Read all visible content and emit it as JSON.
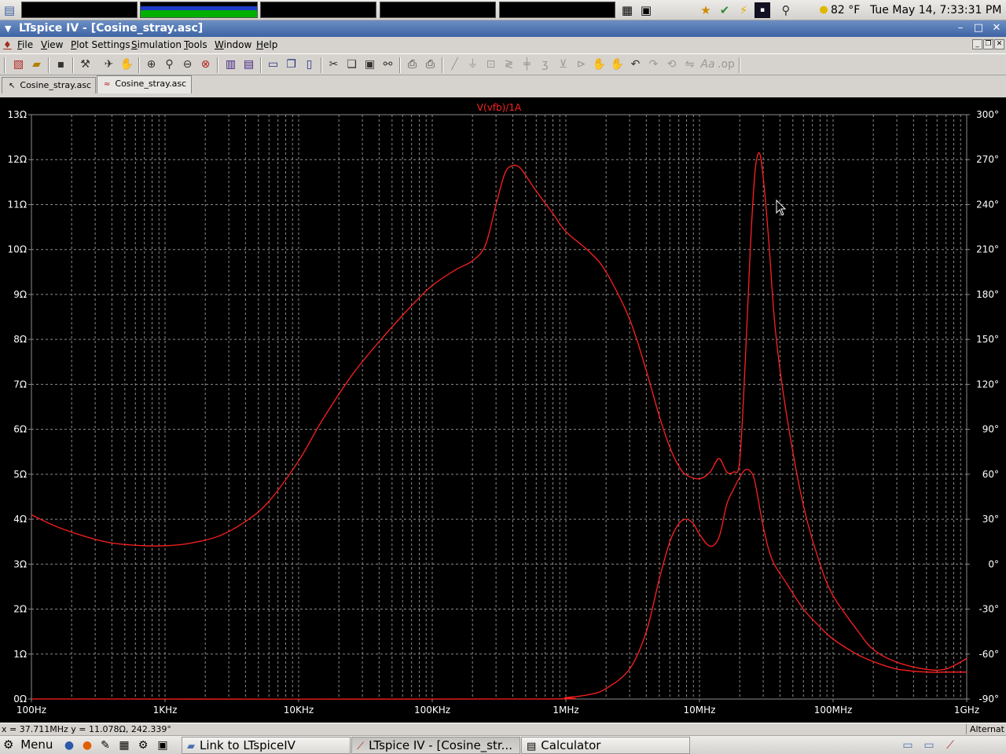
{
  "top_panel": {
    "weather": "82 °F",
    "clock": "Tue May 14,  7:33:31 PM"
  },
  "window": {
    "title": "LTspice IV - [Cosine_stray.asc]"
  },
  "menu": {
    "items": [
      "File",
      "View",
      "Plot Settings",
      "Simulation",
      "Tools",
      "Window",
      "Help"
    ]
  },
  "tabs": [
    {
      "label": "Cosine_stray.asc",
      "icon": "schematic-icon"
    },
    {
      "label": "Cosine_stray.asc",
      "icon": "waveform-icon"
    }
  ],
  "status": {
    "readout": "x = 37.711MHz    y = 11.078Ω, 242.339°",
    "right": "Alternat"
  },
  "taskbar": {
    "menu_label": "Menu",
    "tasks": [
      "Link to LTspiceIV",
      "LTspice IV - [Cosine_str...",
      "Calculator"
    ]
  },
  "colors": {
    "trace": "#ff2020",
    "grid": "#8c8c8c",
    "axis_text": "#ffffff",
    "background": "#000000"
  },
  "chart_data": {
    "type": "line",
    "title": "V(vfb)/1A",
    "x_scale": "log",
    "xlim": [
      100,
      1000000000
    ],
    "x_ticks": [
      "100Hz",
      "1KHz",
      "10KHz",
      "100KHz",
      "1MHz",
      "10MHz",
      "100MHz",
      "1GHz"
    ],
    "y_left_ticks": [
      "0Ω",
      "1Ω",
      "2Ω",
      "3Ω",
      "4Ω",
      "5Ω",
      "6Ω",
      "7Ω",
      "8Ω",
      "9Ω",
      "10Ω",
      "11Ω",
      "12Ω",
      "13Ω"
    ],
    "ylim_left": [
      0,
      13
    ],
    "y_right_ticks": [
      "-90°",
      "-60°",
      "-30°",
      "0°",
      "30°",
      "60°",
      "90°",
      "120°",
      "150°",
      "180°",
      "210°",
      "240°",
      "270°",
      "300°"
    ],
    "ylim_right": [
      -90,
      300
    ],
    "grid": true,
    "series": [
      {
        "axis": "left",
        "x": [
          100,
          150,
          250,
          400,
          700,
          1000,
          1500,
          2500,
          4000,
          6000,
          10000,
          15000,
          25000,
          40000,
          70000,
          100000,
          150000,
          200000,
          250000,
          300000,
          350000,
          400000,
          450000,
          500000,
          600000,
          800000,
          1000000,
          1500000,
          2000000,
          3000000,
          4000000,
          5000000,
          6000000,
          7000000,
          8000000,
          10000000,
          12000000,
          14000000,
          16000000,
          18000000,
          20000000,
          22000000,
          24000000,
          26000000,
          28000000,
          30000000,
          33000000,
          37000000,
          45000000,
          60000000,
          80000000,
          100000000,
          150000000,
          200000000,
          300000000,
          500000000,
          700000000,
          1000000000
        ],
        "values": [
          4.1,
          3.85,
          3.62,
          3.47,
          3.41,
          3.41,
          3.46,
          3.62,
          3.95,
          4.4,
          5.3,
          6.2,
          7.2,
          7.95,
          8.75,
          9.2,
          9.55,
          9.75,
          10.1,
          11.0,
          11.7,
          11.87,
          11.83,
          11.65,
          11.3,
          10.8,
          10.4,
          9.95,
          9.5,
          8.45,
          7.3,
          6.3,
          5.6,
          5.18,
          4.98,
          4.9,
          5.05,
          5.35,
          5.05,
          5.05,
          5.3,
          7.5,
          10.0,
          11.7,
          12.15,
          11.6,
          10.2,
          8.2,
          6.3,
          4.3,
          3.0,
          2.3,
          1.55,
          1.1,
          0.82,
          0.66,
          0.67,
          0.9
        ]
      },
      {
        "axis": "right",
        "x": [
          100,
          500000,
          1000000,
          1500000,
          2000000,
          3000000,
          4000000,
          5000000,
          6000000,
          7000000,
          8000000,
          9000000,
          10000000,
          12000000,
          14000000,
          16000000,
          18000000,
          20000000,
          22000000,
          24000000,
          26000000,
          30000000,
          35000000,
          45000000,
          60000000,
          80000000,
          100000000,
          150000000,
          200000000,
          300000000,
          500000000,
          700000000,
          1000000000
        ],
        "values": [
          -90,
          -90,
          -89,
          -87,
          -83,
          -70,
          -45,
          -10,
          15,
          27,
          30,
          27,
          20,
          12,
          18,
          40,
          50,
          58,
          63,
          62,
          55,
          25,
          3,
          -13,
          -30,
          -42,
          -50,
          -60,
          -65,
          -70,
          -72,
          -72,
          -72
        ]
      }
    ]
  }
}
